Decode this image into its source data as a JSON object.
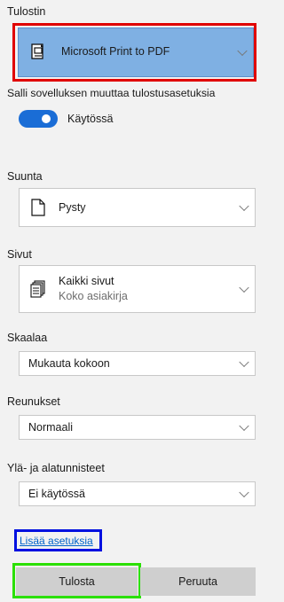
{
  "printer": {
    "label": "Tulostin",
    "selected": "Microsoft Print to PDF",
    "icon": "printer-icon"
  },
  "allow_change": {
    "label": "Salli sovelluksen muuttaa tulostusasetuksia",
    "toggle_state": "Käytössä",
    "toggle_on": true,
    "accent": "#1a6dd6"
  },
  "orientation": {
    "label": "Suunta",
    "selected": "Pysty",
    "icon": "portrait-page-icon"
  },
  "pages": {
    "label": "Sivut",
    "selected": "Kaikki sivut",
    "sub": "Koko asiakirja",
    "icon": "pages-stack-icon"
  },
  "scale": {
    "label": "Skaalaa",
    "selected": "Mukauta kokoon"
  },
  "margins": {
    "label": "Reunukset",
    "selected": "Normaali"
  },
  "headers": {
    "label": "Ylä- ja alatunnisteet",
    "selected": "Ei käytössä"
  },
  "more_settings": {
    "label": "Lisää asetuksia"
  },
  "actions": {
    "print": "Tulosta",
    "cancel": "Peruuta"
  },
  "highlights": {
    "red": "#e00000",
    "blue": "#0010e0",
    "green": "#2be000"
  }
}
